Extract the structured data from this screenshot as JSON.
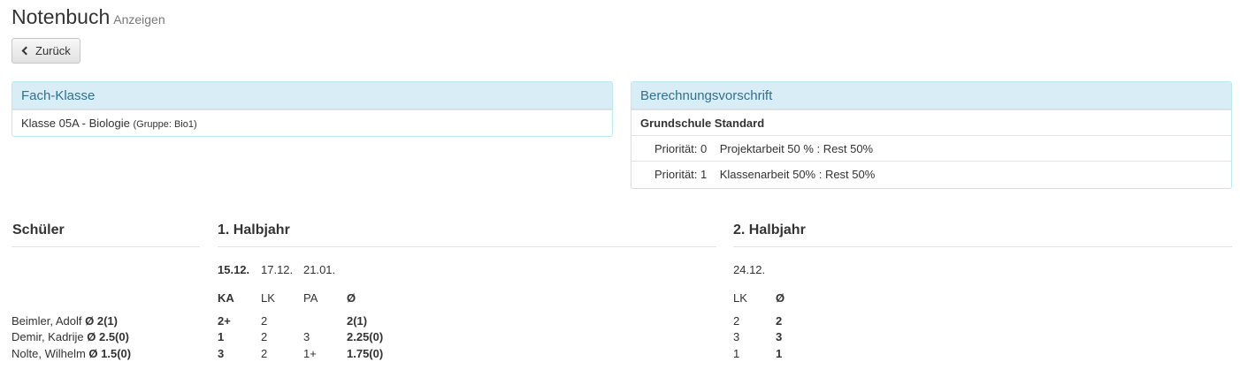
{
  "header": {
    "title": "Notenbuch",
    "subtitle": "Anzeigen"
  },
  "back_button": {
    "label": "Zurück"
  },
  "fach_klasse": {
    "heading": "Fach-Klasse",
    "class_text": "Klasse 05A - Biologie",
    "group_text": "(Gruppe: Bio1)"
  },
  "berechnung": {
    "heading": "Berechnungsvorschrift",
    "name": "Grundschule Standard",
    "rules": [
      {
        "priority": "Priorität: 0",
        "rule": "Projektarbeit 50 % : Rest 50%"
      },
      {
        "priority": "Priorität: 1",
        "rule": "Klassenarbeit 50% : Rest 50%"
      }
    ]
  },
  "grades": {
    "student_header": "Schüler",
    "halbjahr1": {
      "title": "1. Halbjahr",
      "dates": [
        "15.12.",
        "17.12.",
        "21.01."
      ],
      "columns": [
        "KA",
        "LK",
        "PA",
        "Ø"
      ]
    },
    "halbjahr2": {
      "title": "2. Halbjahr",
      "dates": [
        "24.12."
      ],
      "columns": [
        "LK",
        "Ø"
      ]
    },
    "students": [
      {
        "name": "Beimler, Adolf",
        "avg": "Ø 2(1)",
        "h1": [
          "2+",
          "2",
          "",
          "2(1)"
        ],
        "h2": [
          "2",
          "2"
        ]
      },
      {
        "name": "Demir, Kadrije",
        "avg": "Ø 2.5(0)",
        "h1": [
          "1",
          "2",
          "3",
          "2.25(0)"
        ],
        "h2": [
          "3",
          "3"
        ]
      },
      {
        "name": "Nolte, Wilhelm",
        "avg": "Ø 1.5(0)",
        "h1": [
          "3",
          "2",
          "1+",
          "1.75(0)"
        ],
        "h2": [
          "1",
          "1"
        ]
      }
    ]
  }
}
